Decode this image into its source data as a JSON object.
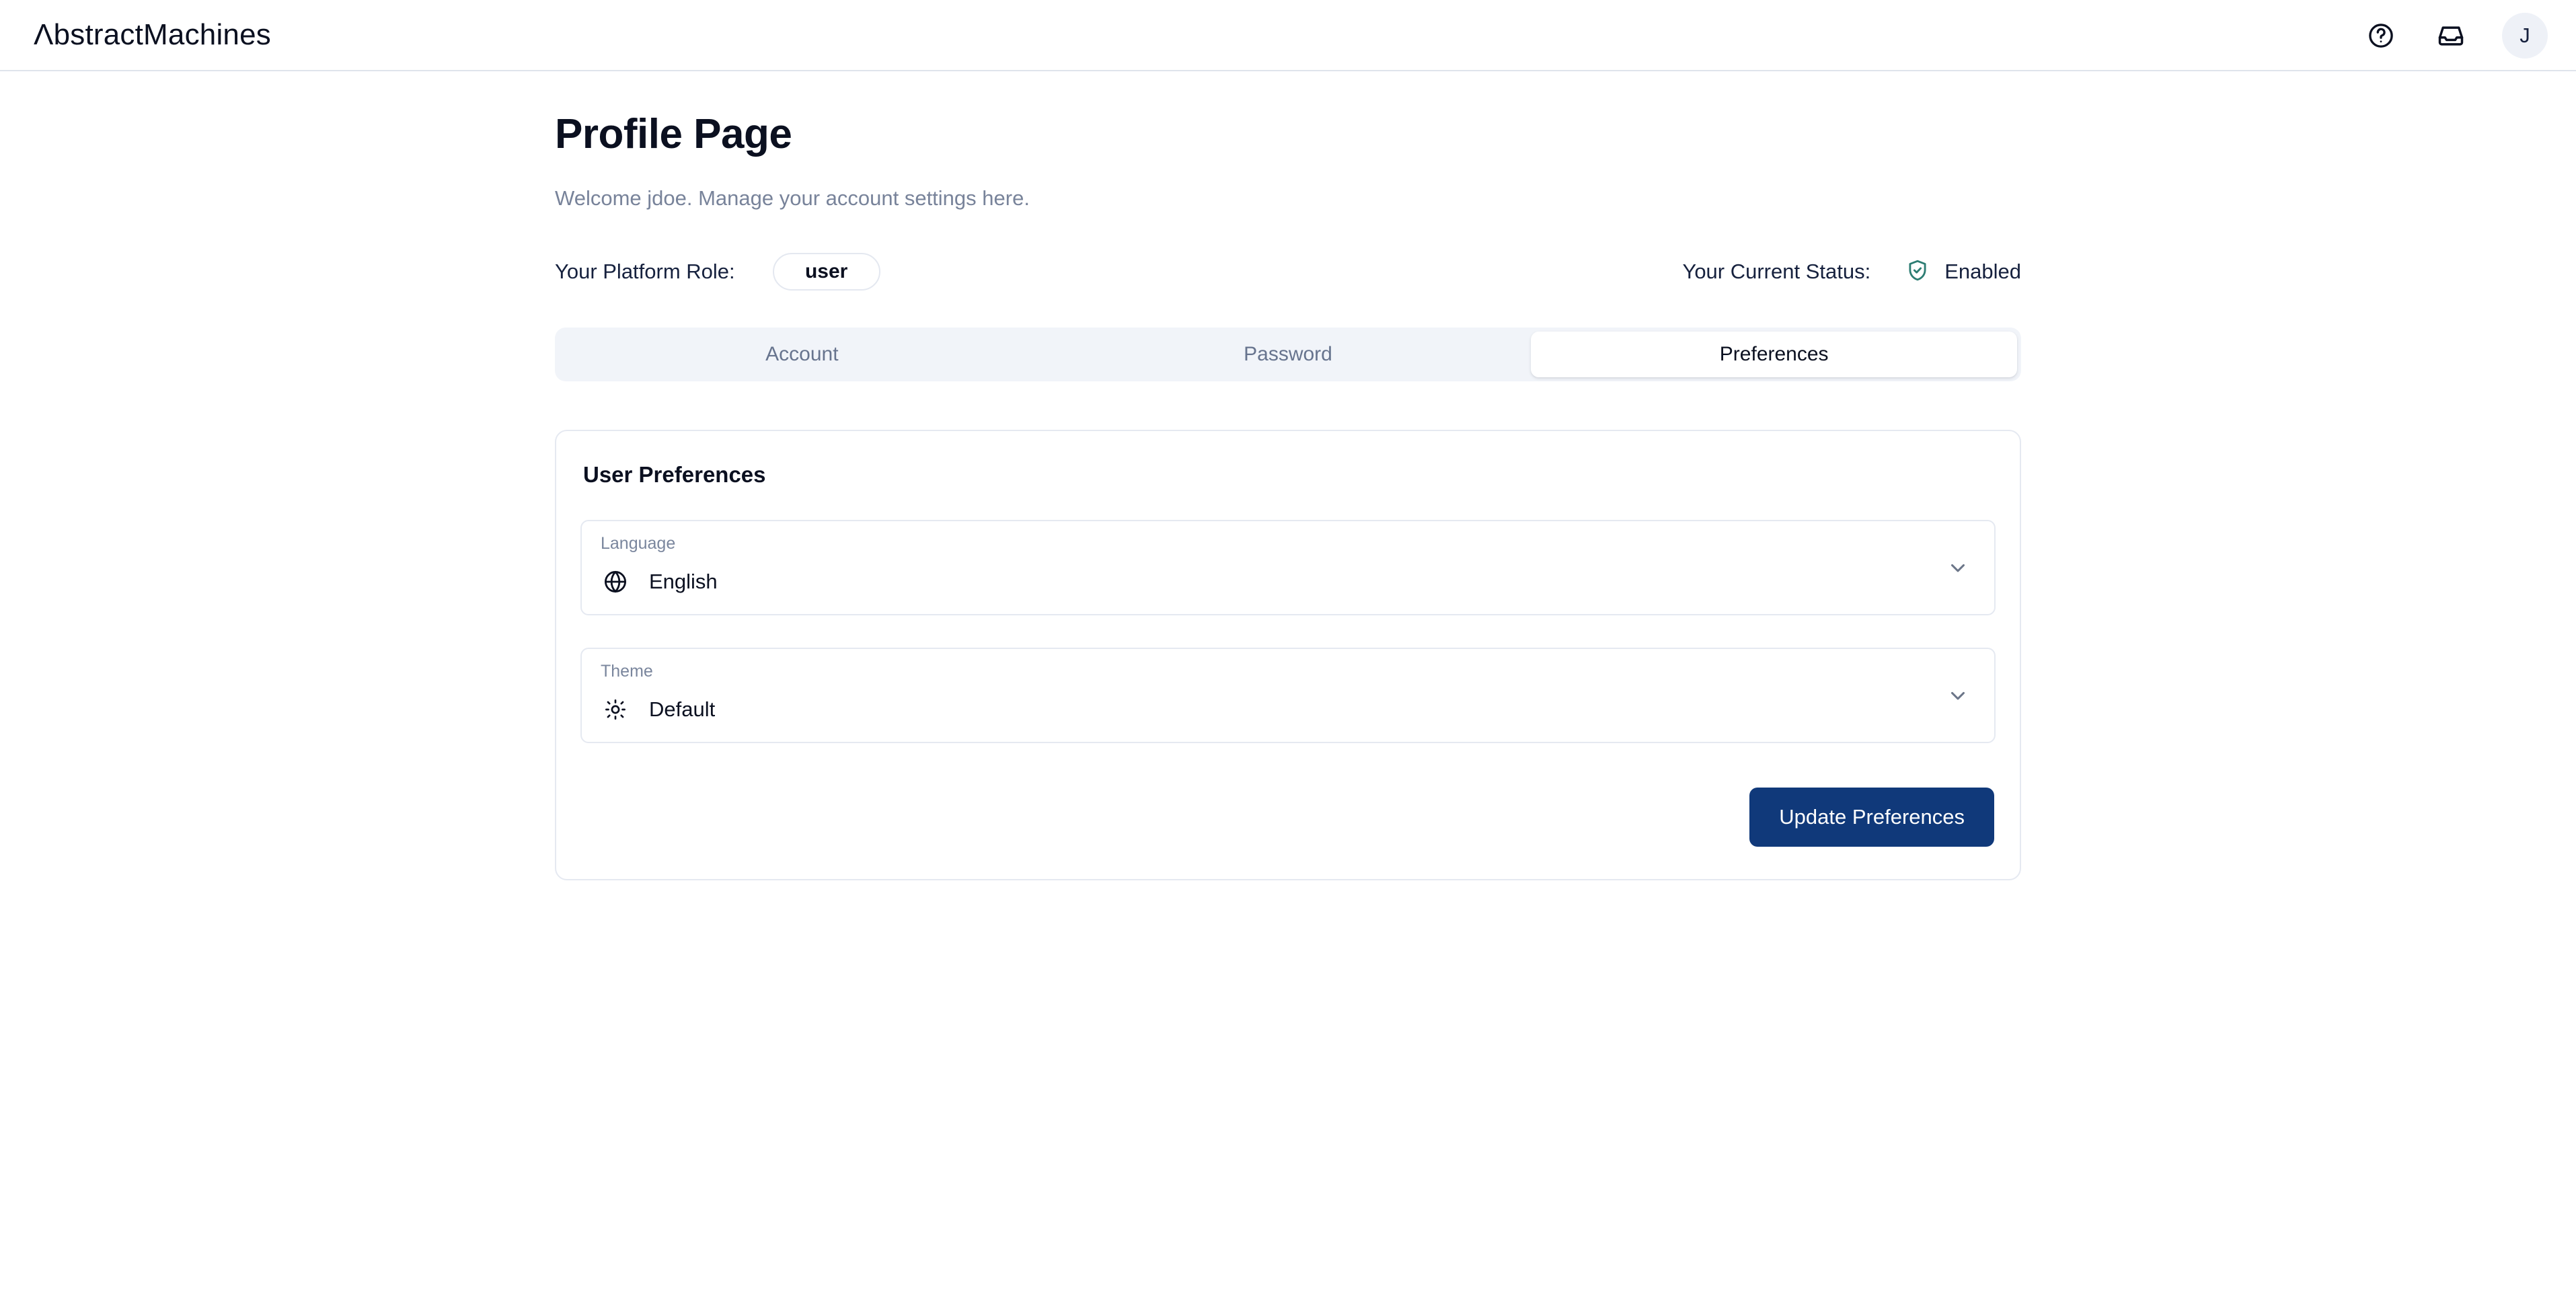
{
  "topbar": {
    "brand": "Abstract Machines",
    "brand_first_letter": "Λ",
    "brand_part1": "bstract ",
    "brand_m": "M",
    "brand_part2": "achines",
    "help_icon": "help-circle-icon",
    "inbox_icon": "inbox-icon",
    "avatar_initial": "J"
  },
  "header": {
    "title": "Profile Page",
    "subtitle": "Welcome jdoe. Manage your account settings here."
  },
  "meta": {
    "role_label": "Your Platform Role:",
    "role_value": "user",
    "status_label": "Your Current Status:",
    "status_value": "Enabled",
    "status_icon": "shield-check-icon",
    "status_color": "#2d7d73"
  },
  "tabs": [
    {
      "label": "Account",
      "active": false
    },
    {
      "label": "Password",
      "active": false
    },
    {
      "label": "Preferences",
      "active": true
    }
  ],
  "card": {
    "title": "User Preferences",
    "fields": [
      {
        "label": "Language",
        "value": "English",
        "icon": "globe-icon",
        "chevron": "chevron-down-icon"
      },
      {
        "label": "Theme",
        "value": "Default",
        "icon": "sun-icon",
        "chevron": "chevron-down-icon"
      }
    ],
    "submit_label": "Update Preferences"
  },
  "colors": {
    "primary": "#10397a",
    "muted": "#78839a",
    "border": "#e5e9f1",
    "tab_track": "#f1f4f9",
    "accent_teal": "#2d7d73",
    "avatar_bg": "#eef1f7"
  }
}
